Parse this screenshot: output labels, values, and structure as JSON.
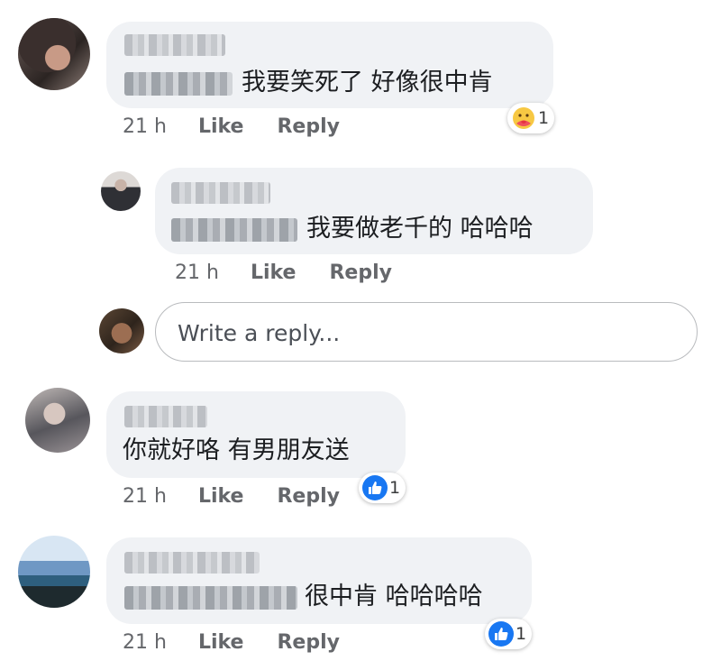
{
  "comments": [
    {
      "text": "我要笑死了 好像很中肯",
      "time": "21 h",
      "like_label": "Like",
      "reply_label": "Reply",
      "reaction": {
        "icon": "care-icon",
        "count": "1"
      }
    },
    {
      "text": "我要做老千的 哈哈哈",
      "time": "21 h",
      "like_label": "Like",
      "reply_label": "Reply"
    },
    {
      "text": "你就好咯 有男朋友送",
      "time": "21 h",
      "like_label": "Like",
      "reply_label": "Reply",
      "reaction": {
        "icon": "like-icon",
        "count": "1"
      }
    },
    {
      "text": "很中肯 哈哈哈哈",
      "time": "21 h",
      "like_label": "Like",
      "reply_label": "Reply",
      "reaction": {
        "icon": "like-icon",
        "count": "1"
      }
    }
  ],
  "reply_input": {
    "placeholder": "Write a reply..."
  },
  "colors": {
    "bubble": "#f0f2f5",
    "meta_text": "#65676b",
    "like_blue": "#1877f2",
    "border": "#b9bbbe"
  }
}
